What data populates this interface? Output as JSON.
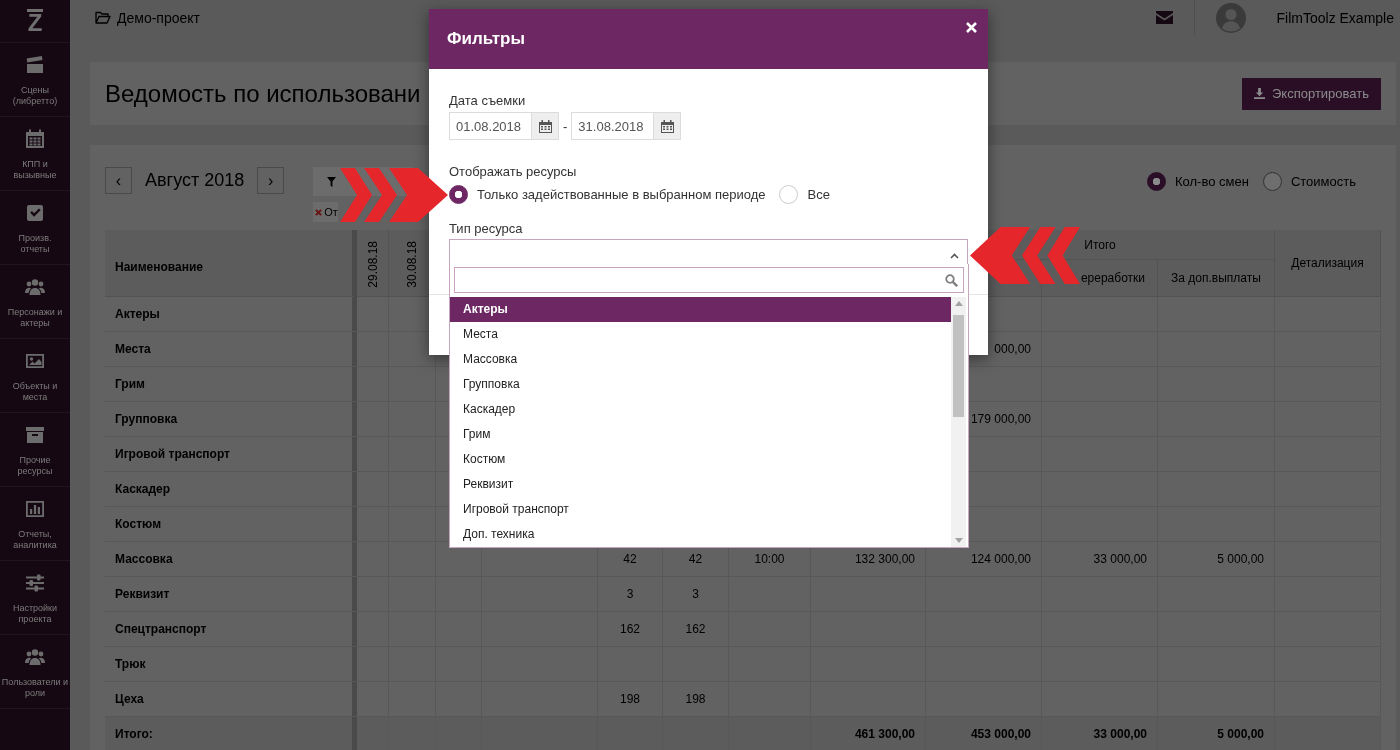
{
  "sidebar": {
    "logo": "Z",
    "items": [
      {
        "label": "Сцены\n(либретто)"
      },
      {
        "label": "КПП и\nвызывные"
      },
      {
        "label": "Произв.\nотчеты"
      },
      {
        "label": "Персонажи и\nактеры"
      },
      {
        "label": "Объекты и\nместа"
      },
      {
        "label": "Прочие\nресурсы"
      },
      {
        "label": "Отчеты,\nаналитика"
      },
      {
        "label": "Настройки\nпроекта"
      },
      {
        "label": "Пользователи и\nроли"
      }
    ]
  },
  "topbar": {
    "project": "Демо-проект",
    "user": "FilmToolz Example"
  },
  "header": {
    "title": "Ведомость по использовани",
    "export_button": "Экспортировать"
  },
  "toolbar": {
    "prev_button": "‹",
    "month": "Август 2018",
    "next_button": "›",
    "active_filter": "От",
    "view_options": [
      {
        "label": "Кол-во смен",
        "selected": true
      },
      {
        "label": "Стоимость",
        "selected": false
      }
    ]
  },
  "table": {
    "name_header": "Наименование",
    "date_headers": [
      "29.08.18",
      "30.08.18"
    ],
    "group_header": "Итого",
    "sub_headers": [
      "ереработки",
      "За доп.выплаты"
    ],
    "detail_header": "Детализация",
    "rows": [
      {
        "name": "Актеры",
        "kind": "item"
      },
      {
        "name": "Места",
        "kind": "item",
        "values": {
          "column_9": "000,00"
        }
      },
      {
        "name": "Грим",
        "kind": "item"
      },
      {
        "name": "Групповка",
        "kind": "item",
        "values": {
          "column_9": "179 000,00"
        }
      },
      {
        "name": "Игровой транспорт",
        "kind": "item"
      },
      {
        "name": "Каскадер",
        "kind": "item"
      },
      {
        "name": "Костюм",
        "kind": "item"
      },
      {
        "name": "Массовка",
        "kind": "item",
        "values": {
          "column_5": "42",
          "column_6": "42",
          "column_7": "10:00",
          "column_8": "132 300,00",
          "column_9": "124 000,00",
          "column_10": "33 000,00",
          "column_11": "5 000,00"
        }
      },
      {
        "name": "Реквизит",
        "kind": "item",
        "values": {
          "column_5": "3",
          "column_6": "3"
        }
      },
      {
        "name": "Спецтранспорт",
        "kind": "item",
        "values": {
          "column_5": "162",
          "column_6": "162"
        }
      },
      {
        "name": "Трюк",
        "kind": "item"
      },
      {
        "name": "Цеха",
        "kind": "item",
        "values": {
          "column_5": "198",
          "column_6": "198"
        }
      },
      {
        "name": "Итого:",
        "kind": "total",
        "values": {
          "column_8": "461 300,00",
          "column_9": "453 000,00",
          "column_10": "33 000,00",
          "column_11": "5 000,00"
        }
      }
    ]
  },
  "filter_dialog": {
    "title": "Фильтры",
    "date_label": "Дата съемки",
    "date_from": "01.08.2018",
    "date_separator": "-",
    "date_to": "31.08.2018",
    "resources_label": "Отображать ресурсы",
    "resource_options": [
      {
        "label": "Только задействованные в выбранном периоде",
        "selected": true
      },
      {
        "label": "Все",
        "selected": false
      }
    ],
    "type_label": "Тип ресурса",
    "type_select": {
      "expanded": true,
      "options": [
        {
          "label": "Актеры",
          "selected": true
        },
        {
          "label": "Места",
          "selected": false
        },
        {
          "label": "Массовка",
          "selected": false
        },
        {
          "label": "Групповка",
          "selected": false
        },
        {
          "label": "Каскадер",
          "selected": false
        },
        {
          "label": "Грим",
          "selected": false
        },
        {
          "label": "Костюм",
          "selected": false
        },
        {
          "label": "Реквизит",
          "selected": false
        },
        {
          "label": "Игровой транспорт",
          "selected": false
        },
        {
          "label": "Доп. техника",
          "selected": false
        }
      ]
    }
  }
}
